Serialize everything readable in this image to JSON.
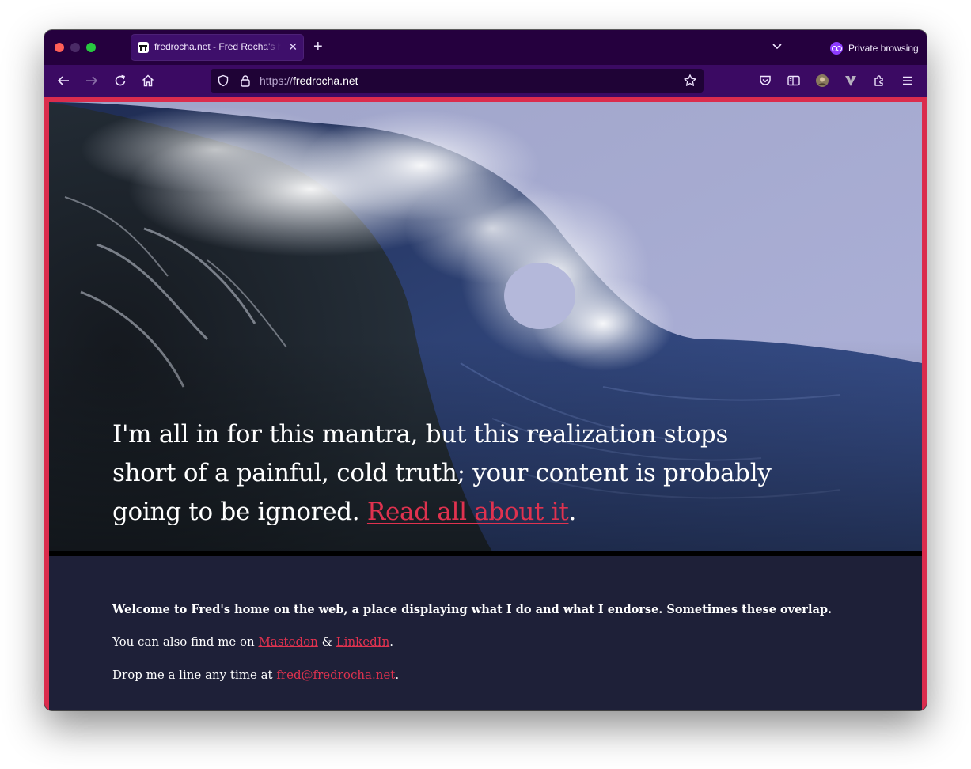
{
  "browser": {
    "tab_title": "fredrocha.net - Fred Rocha's home",
    "tab_close_glyph": "✕",
    "new_tab_glyph": "+",
    "private_label": "Private browsing",
    "url_scheme": "https://",
    "url_host": "fredrocha.net",
    "icons": [
      "back-icon",
      "forward-icon",
      "reload-icon",
      "home-icon",
      "shield-icon",
      "lock-icon",
      "bookmark-star-icon",
      "pocket-icon",
      "sidebar-icon",
      "profile-avatar-icon",
      "extension-v-icon",
      "extensions-puzzle-icon",
      "menu-icon",
      "tab-list-chevron-icon",
      "private-mask-icon"
    ],
    "colors": {
      "tabstrip": "#25003e",
      "navbar": "#3b0a63",
      "urlbar": "#1f0336"
    }
  },
  "page": {
    "hero_quote_text": "I'm all in for this mantra, but this realization stops short of a painful, cold truth; your content is probably going to be ignored. ",
    "hero_link_text": "Read all about it",
    "hero_trailing": ".",
    "welcome_text": "Welcome to Fred's home on the web, a place displaying what I do and what I endorse. Sometimes these overlap.",
    "social_prefix": "You can also find me on ",
    "mastodon_label": "Mastodon",
    "social_amp": " & ",
    "linkedin_label": "LinkedIn",
    "social_suffix": ".",
    "contact_prefix": "Drop me a line any time at ",
    "email_label": "fred@fredrocha.net",
    "contact_suffix": ".",
    "colors": {
      "frame": "#db2c4d",
      "accent_link": "#e0324f",
      "lower_bg": "#1e2038"
    }
  }
}
